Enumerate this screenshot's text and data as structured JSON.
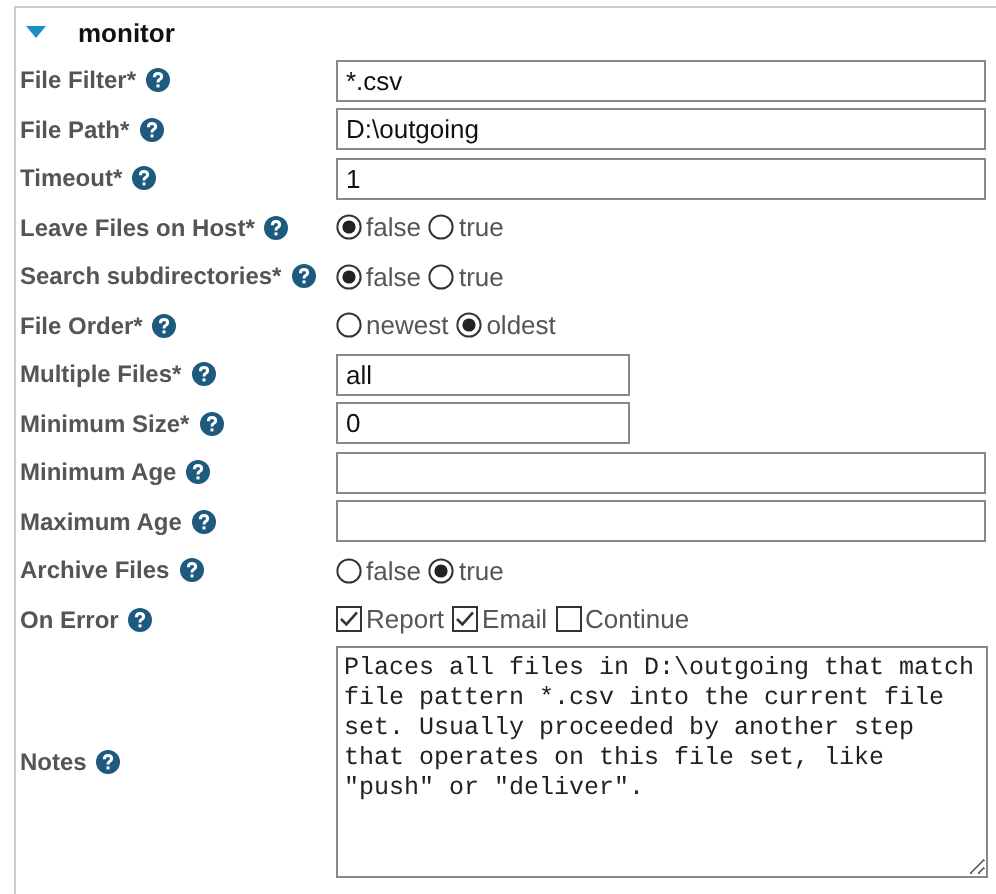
{
  "section": {
    "title": "monitor",
    "expanded": true
  },
  "fields": [
    {
      "label": "File Filter*",
      "kind": "text",
      "value": "*.csv"
    },
    {
      "label": "File Path*",
      "kind": "text",
      "value": "D:\\outgoing"
    },
    {
      "label": "Timeout*",
      "kind": "text",
      "value": "1"
    },
    {
      "label": "Leave Files on Host*",
      "kind": "radio",
      "options": [
        {
          "label": "false",
          "selected": true
        },
        {
          "label": "true",
          "selected": false
        }
      ]
    },
    {
      "label": "Search subdirectories*",
      "kind": "radio",
      "options": [
        {
          "label": "false",
          "selected": true
        },
        {
          "label": "true",
          "selected": false
        }
      ]
    },
    {
      "label": "File Order*",
      "kind": "radio",
      "options": [
        {
          "label": "newest",
          "selected": false
        },
        {
          "label": "oldest",
          "selected": true
        }
      ]
    },
    {
      "label": "Multiple Files*",
      "kind": "short-text",
      "value": "all"
    },
    {
      "label": "Minimum Size*",
      "kind": "short-text",
      "value": "0"
    },
    {
      "label": "Minimum Age",
      "kind": "text"
    },
    {
      "label": "Maximum Age",
      "kind": "text"
    },
    {
      "label": "Archive Files",
      "kind": "radio",
      "options": [
        {
          "label": "false",
          "selected": false
        },
        {
          "label": "true",
          "selected": true
        }
      ]
    },
    {
      "label": "On Error",
      "kind": "checkboxes",
      "options": [
        {
          "label": "Report",
          "checked": true
        },
        {
          "label": "Email",
          "checked": true
        },
        {
          "label": "Continue",
          "checked": false
        }
      ]
    },
    {
      "label": "Notes",
      "kind": "textarea",
      "value": "Places all files in D:\\outgoing that match file pattern *.csv into the current file set. Usually proceeded by another step that operates on this file set, like \"push\" or \"deliver\"."
    }
  ]
}
